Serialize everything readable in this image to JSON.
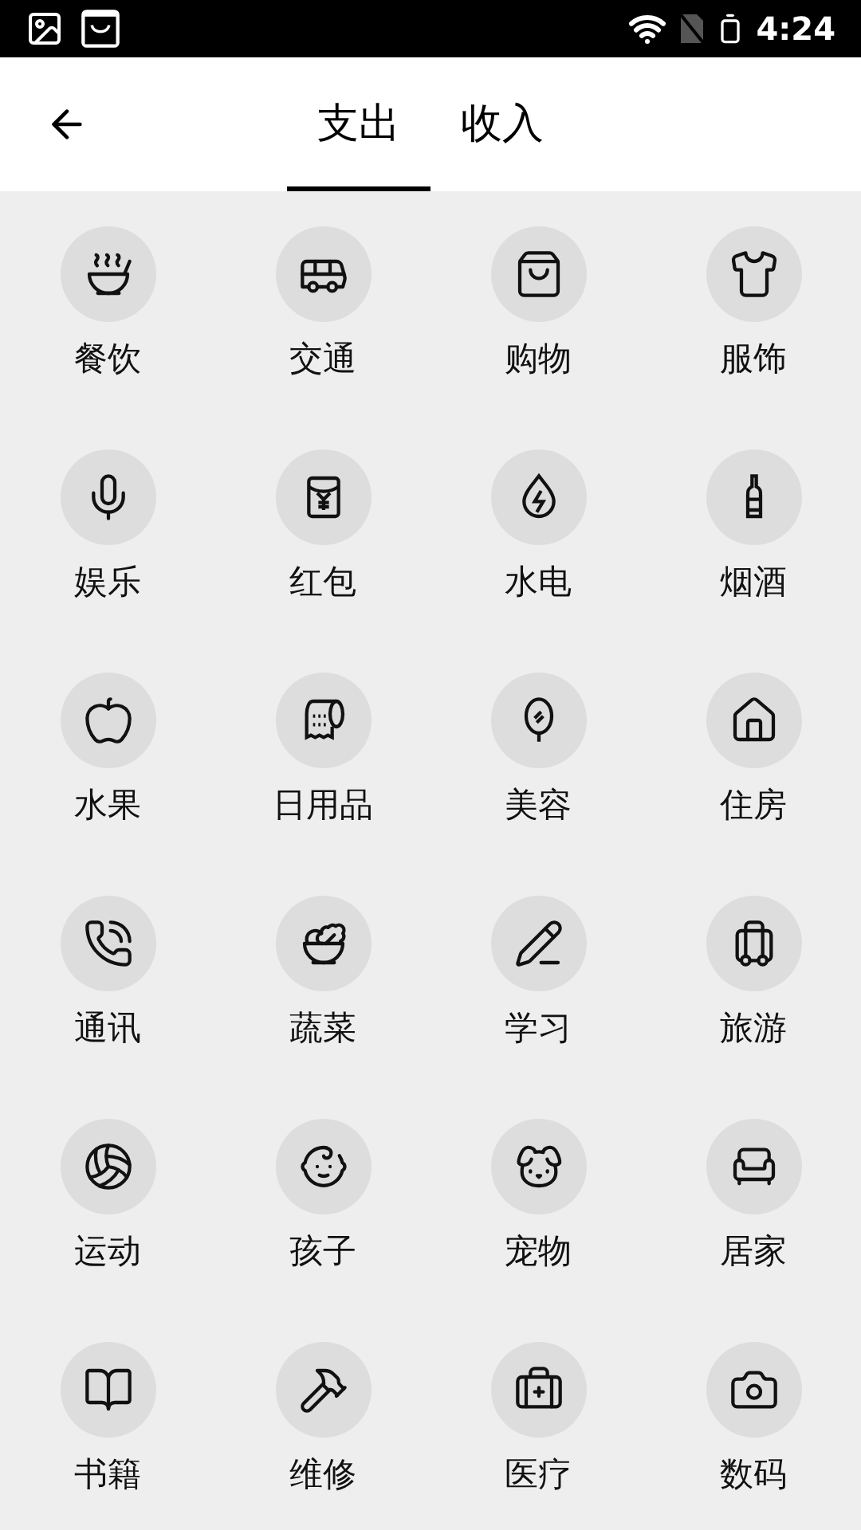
{
  "status_bar": {
    "time": "4:24"
  },
  "tabs": [
    {
      "label": "支出",
      "selected": true
    },
    {
      "label": "收入",
      "selected": false
    }
  ],
  "categories": [
    {
      "label": "餐饮"
    },
    {
      "label": "交通"
    },
    {
      "label": "购物"
    },
    {
      "label": "服饰"
    },
    {
      "label": "娱乐"
    },
    {
      "label": "红包"
    },
    {
      "label": "水电"
    },
    {
      "label": "烟酒"
    },
    {
      "label": "水果"
    },
    {
      "label": "日用品"
    },
    {
      "label": "美容"
    },
    {
      "label": "住房"
    },
    {
      "label": "通讯"
    },
    {
      "label": "蔬菜"
    },
    {
      "label": "学习"
    },
    {
      "label": "旅游"
    },
    {
      "label": "运动"
    },
    {
      "label": "孩子"
    },
    {
      "label": "宠物"
    },
    {
      "label": "居家"
    },
    {
      "label": "书籍"
    },
    {
      "label": "维修"
    },
    {
      "label": "医疗"
    },
    {
      "label": "数码"
    }
  ]
}
